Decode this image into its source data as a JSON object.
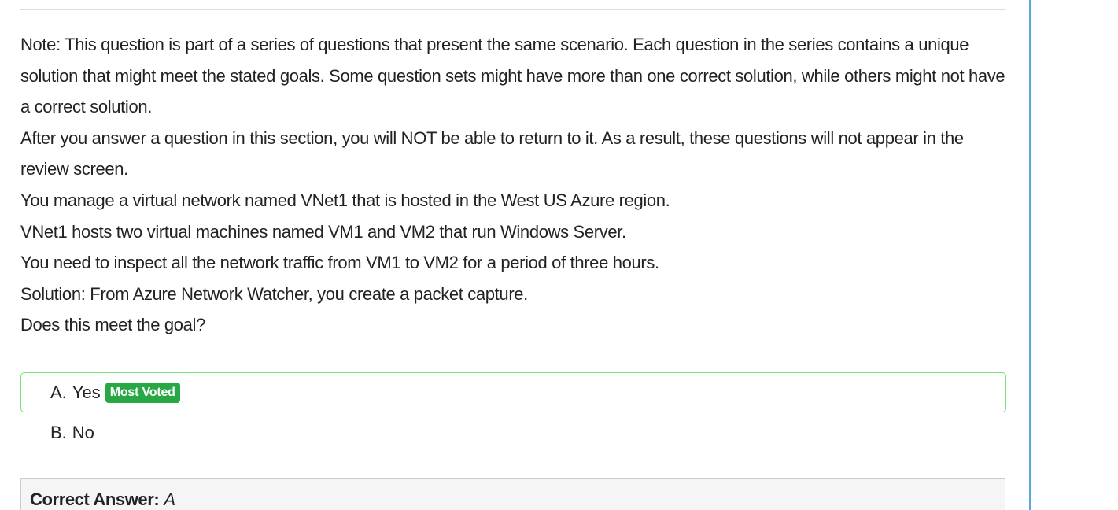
{
  "question": {
    "paragraphs": [
      "Note: This question is part of a series of questions that present the same scenario. Each question in the series contains a unique solution that might meet the stated goals. Some question sets might have more than one correct solution, while others might not have a correct solution.",
      "After you answer a question in this section, you will NOT be able to return to it. As a result, these questions will not appear in the review screen.",
      "You manage a virtual network named VNet1 that is hosted in the West US Azure region.",
      "VNet1 hosts two virtual machines named VM1 and VM2 that run Windows Server.",
      "You need to inspect all the network traffic from VM1 to VM2 for a period of three hours.",
      "Solution: From Azure Network Watcher, you create a packet capture.",
      "Does this meet the goal?"
    ]
  },
  "choices": [
    {
      "letter": "A.",
      "text": "Yes",
      "badge": "Most Voted"
    },
    {
      "letter": "B.",
      "text": "No"
    }
  ],
  "answer": {
    "label": "Correct Answer:",
    "value": "A"
  },
  "colors": {
    "voted_border": "#79e279",
    "badge_bg": "#28a745",
    "side_border": "#5aa9dc"
  }
}
